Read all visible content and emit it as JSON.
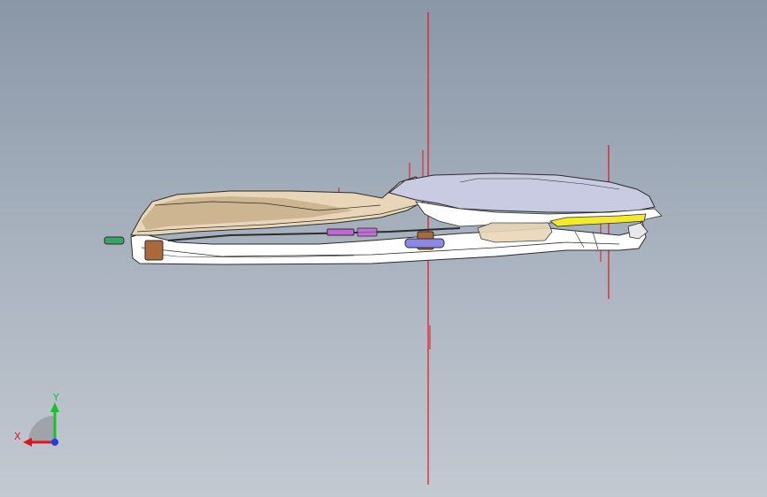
{
  "viewport": {
    "background_top": "#8a97a7",
    "background_bottom": "#c3c9d1"
  },
  "model": {
    "part_colors": {
      "cover_shell": "#e9d6b8",
      "cover_shadow": "#b69a73",
      "armrest_lid": "#c9cbe3",
      "base_frame": "#ffffff",
      "outline": "#2c2c2c",
      "latch_yellow": "#f2ea2a",
      "bracket_brown": "#a86a3c",
      "connector_green": "#3aa36a",
      "pad_blue": "#8c88e6",
      "wire_magenta": "#c466d6",
      "axis_line": "#e0141a"
    }
  },
  "triad": {
    "x_label": "X",
    "y_label": "Y",
    "x_color": "#e0141a",
    "y_color": "#18c02a",
    "z_color": "#1f3ee0"
  }
}
